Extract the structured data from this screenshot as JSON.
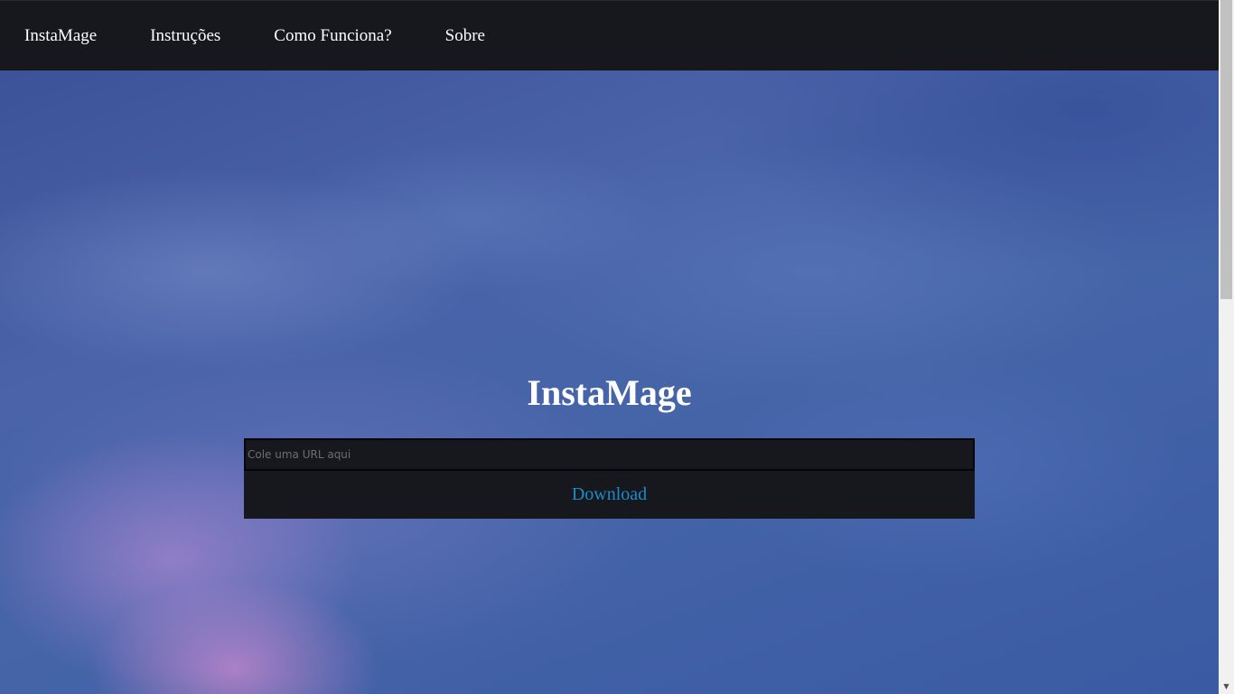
{
  "navbar": {
    "links": [
      {
        "label": "InstaMage"
      },
      {
        "label": "Instruções"
      },
      {
        "label": "Como Funciona?"
      },
      {
        "label": "Sobre"
      }
    ]
  },
  "main": {
    "title": "InstaMage",
    "url_input": {
      "placeholder": "Cole uma URL aqui",
      "value": ""
    },
    "download_label": "Download"
  },
  "colors": {
    "navbar_bg": "#17181d",
    "link_text": "#ffffff",
    "download_text": "#1a8ccc",
    "sky_base": "#3b5aa0"
  },
  "icons": {
    "scroll_down": "chevron-down-icon"
  }
}
